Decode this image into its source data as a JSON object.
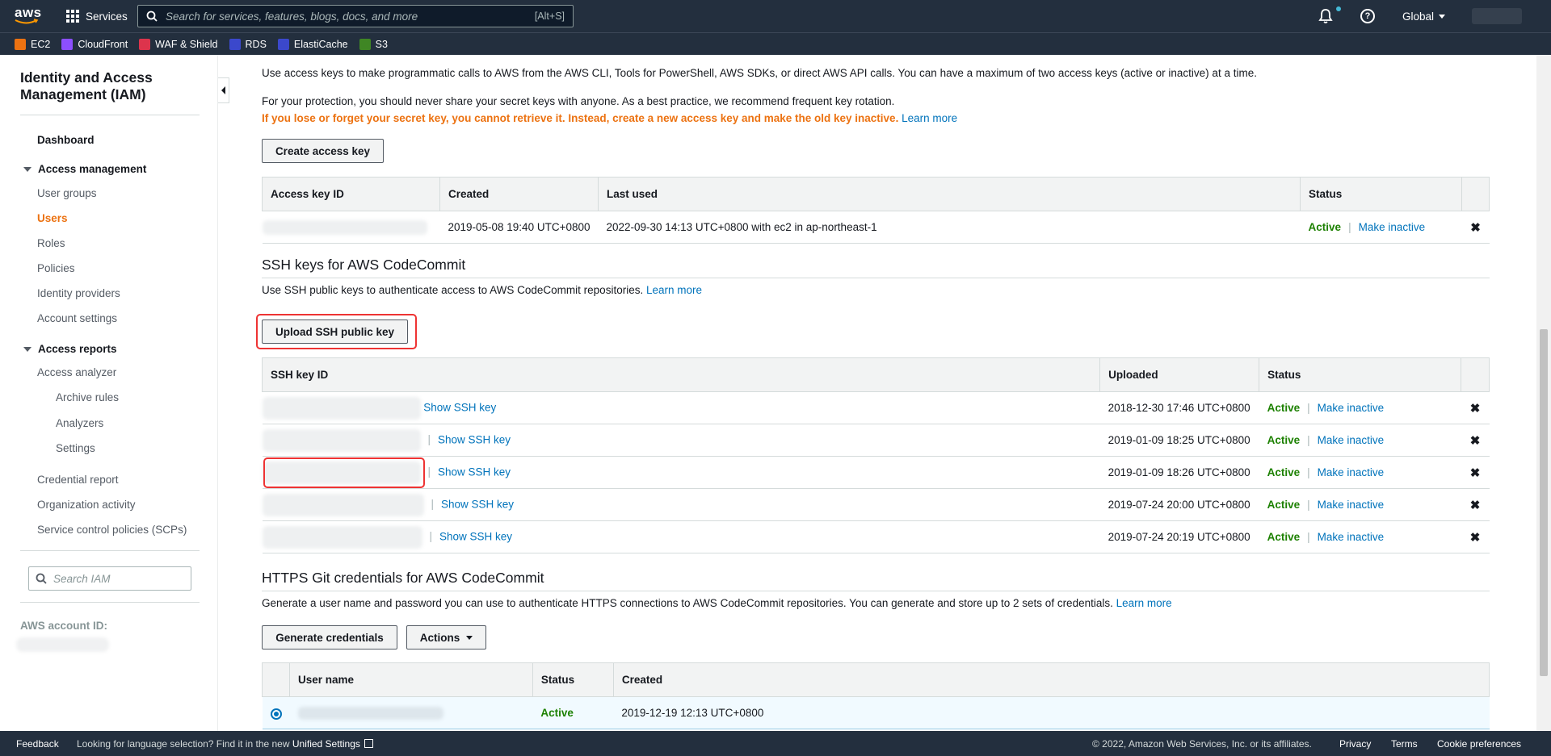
{
  "topnav": {
    "logo": "aws",
    "services_label": "Services",
    "search_placeholder": "Search for services, features, blogs, docs, and more",
    "search_shortcut": "[Alt+S]",
    "region_label": "Global"
  },
  "favorites": [
    {
      "label": "EC2",
      "color": "#ec7211"
    },
    {
      "label": "CloudFront",
      "color": "#8c4fff"
    },
    {
      "label": "WAF & Shield",
      "color": "#dd344c"
    },
    {
      "label": "RDS",
      "color": "#3b48cc"
    },
    {
      "label": "ElastiCache",
      "color": "#3b48cc"
    },
    {
      "label": "S3",
      "color": "#3f8624"
    }
  ],
  "sidebar": {
    "title": "Identity and Access Management (IAM)",
    "dashboard": "Dashboard",
    "access_management": "Access management",
    "user_groups": "User groups",
    "users": "Users",
    "roles": "Roles",
    "policies": "Policies",
    "identity_providers": "Identity providers",
    "account_settings": "Account settings",
    "access_reports": "Access reports",
    "access_analyzer": "Access analyzer",
    "archive_rules": "Archive rules",
    "analyzers": "Analyzers",
    "settings": "Settings",
    "credential_report": "Credential report",
    "organization_activity": "Organization activity",
    "scps": "Service control policies (SCPs)",
    "search_placeholder": "Search IAM",
    "account_id_label": "AWS account ID:"
  },
  "access_keys": {
    "intro": "Use access keys to make programmatic calls to AWS from the AWS CLI, Tools for PowerShell, AWS SDKs, or direct AWS API calls. You can have a maximum of two access keys (active or inactive) at a time.",
    "protection": "For your protection, you should never share your secret keys with anyone. As a best practice, we recommend frequent key rotation.",
    "warning": "If you lose or forget your secret key, you cannot retrieve it. Instead, create a new access key and make the old key inactive.",
    "learn_more": "Learn more",
    "create_button": "Create access key",
    "columns": {
      "id": "Access key ID",
      "created": "Created",
      "last_used": "Last used",
      "status": "Status"
    },
    "rows": [
      {
        "created": "2019-05-08 19:40 UTC+0800",
        "last_used": "2022-09-30 14:13 UTC+0800 with ec2 in ap-northeast-1",
        "status": "Active",
        "action": "Make inactive"
      }
    ]
  },
  "ssh_keys": {
    "heading": "SSH keys for AWS CodeCommit",
    "description": "Use SSH public keys to authenticate access to AWS CodeCommit repositories.",
    "learn_more": "Learn more",
    "upload_button": "Upload SSH public key",
    "columns": {
      "id": "SSH key ID",
      "uploaded": "Uploaded",
      "status": "Status"
    },
    "show_label": "Show SSH key",
    "rows": [
      {
        "uploaded": "2018-12-30 17:46 UTC+0800",
        "status": "Active",
        "action": "Make inactive"
      },
      {
        "uploaded": "2019-01-09 18:25 UTC+0800",
        "status": "Active",
        "action": "Make inactive"
      },
      {
        "uploaded": "2019-01-09 18:26 UTC+0800",
        "status": "Active",
        "action": "Make inactive"
      },
      {
        "uploaded": "2019-07-24 20:00 UTC+0800",
        "status": "Active",
        "action": "Make inactive"
      },
      {
        "uploaded": "2019-07-24 20:19 UTC+0800",
        "status": "Active",
        "action": "Make inactive"
      }
    ]
  },
  "https_git": {
    "heading": "HTTPS Git credentials for AWS CodeCommit",
    "description": "Generate a user name and password you can use to authenticate HTTPS connections to AWS CodeCommit repositories. You can generate and store up to 2 sets of credentials.",
    "learn_more": "Learn more",
    "generate_button": "Generate credentials",
    "actions_button": "Actions",
    "columns": {
      "user": "User name",
      "status": "Status",
      "created": "Created"
    },
    "rows": [
      {
        "status": "Active",
        "created": "2019-12-19 12:13 UTC+0800",
        "selected": true
      }
    ]
  },
  "footer": {
    "feedback": "Feedback",
    "language_text": "Looking for language selection? Find it in the new",
    "unified_settings": "Unified Settings",
    "copyright": "© 2022, Amazon Web Services, Inc. or its affiliates.",
    "privacy": "Privacy",
    "terms": "Terms",
    "cookies": "Cookie preferences"
  }
}
